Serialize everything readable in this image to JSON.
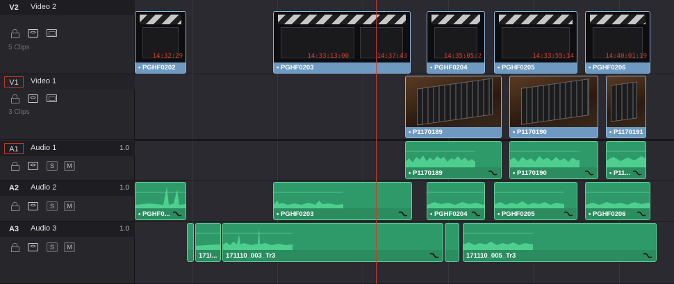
{
  "tracks": [
    {
      "id": "V2",
      "name": "Video 2",
      "clip_count": "5 Clips",
      "level": "",
      "boxed": false,
      "type": "video"
    },
    {
      "id": "V1",
      "name": "Video 1",
      "clip_count": "3 Clips",
      "level": "",
      "boxed": true,
      "type": "video"
    },
    {
      "id": "A1",
      "name": "Audio 1",
      "clip_count": "",
      "level": "1.0",
      "boxed": true,
      "type": "audio"
    },
    {
      "id": "A2",
      "name": "Audio 2",
      "clip_count": "",
      "level": "1.0",
      "boxed": false,
      "type": "audio"
    },
    {
      "id": "A3",
      "name": "Audio 3",
      "clip_count": "",
      "level": "1.0",
      "boxed": false,
      "type": "audio"
    }
  ],
  "buttons": {
    "solo": "S",
    "mute": "M",
    "link": "<>"
  },
  "clips": {
    "v2": [
      {
        "name": "• PGHF0202",
        "timecode": "14:32:29"
      },
      {
        "name": "• PGHF0203",
        "timecode": "14:33:13:00",
        "timecode2": "14:37:43"
      },
      {
        "name": "• PGHF0204",
        "timecode": "14:35:05:2"
      },
      {
        "name": "• PGHF0205",
        "timecode": "14:33:55:14"
      },
      {
        "name": "• PGHF0206",
        "timecode": "14:40:01:19"
      }
    ],
    "v1": [
      {
        "name": "• P1170189"
      },
      {
        "name": "• P1170190"
      },
      {
        "name": "• P1170191"
      }
    ],
    "a1": [
      {
        "name": "• P1170189"
      },
      {
        "name": "• P1170190"
      },
      {
        "name": "• P11..."
      }
    ],
    "a2": [
      {
        "name": "• PGHF0..."
      },
      {
        "name": "• PGHF0203"
      },
      {
        "name": "• PGHF0204"
      },
      {
        "name": "• PGHF0205"
      },
      {
        "name": "• PGHF0206"
      }
    ],
    "a3": [
      {
        "name": ""
      },
      {
        "name": "171l..."
      },
      {
        "name": "171110_003_Tr3"
      },
      {
        "name": ""
      },
      {
        "name": "171110_005_Tr3"
      }
    ]
  },
  "colors": {
    "video_clip": "#6e9ac2",
    "audio_clip": "#2e9a6a",
    "playhead": "#d33a2c",
    "selected_track_box": "#c0392b"
  }
}
